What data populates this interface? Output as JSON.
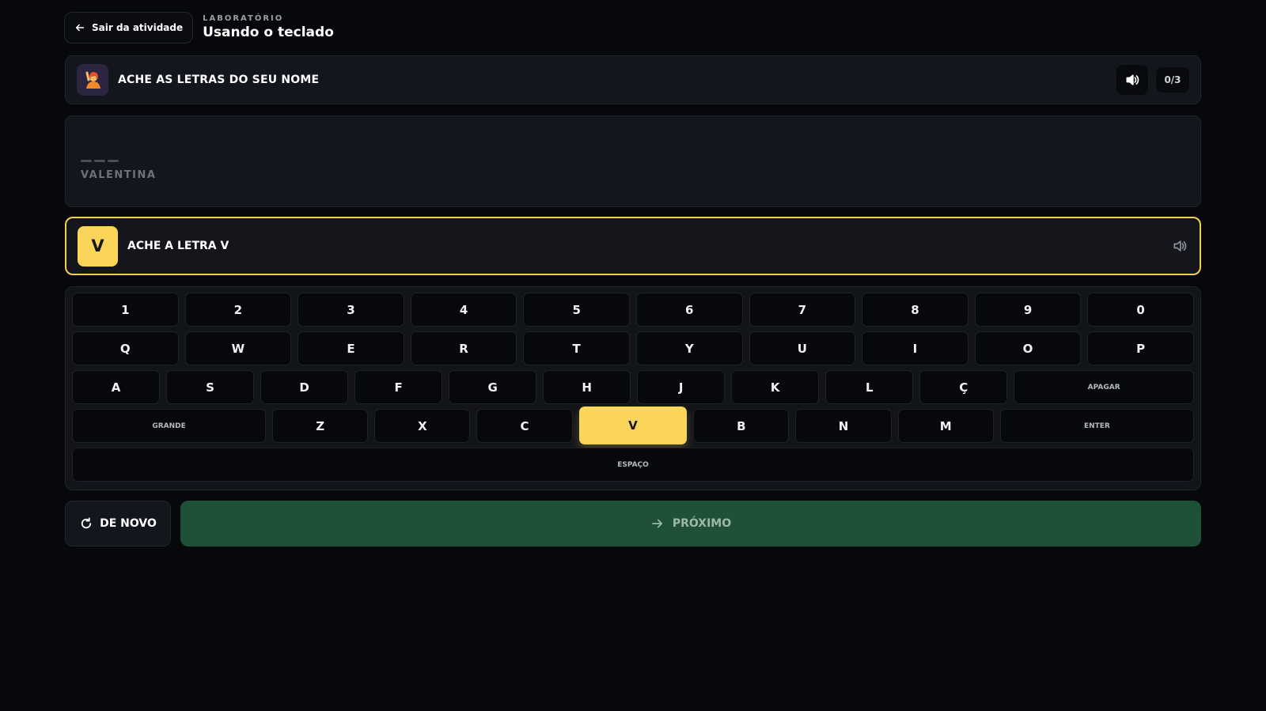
{
  "header": {
    "exit_label": "Sair da atividade",
    "section": "LABORATÓRIO",
    "title": "Usando o teclado"
  },
  "task": {
    "title": "ACHE AS LETRAS DO SEU NOME",
    "progress": "0/3",
    "icon": "person-raising-hand-icon"
  },
  "name_display": {
    "name": "VALENTINA"
  },
  "current_letter": {
    "letter": "V",
    "prompt": "ACHE A LETRA V"
  },
  "keyboard": {
    "row1": [
      "1",
      "2",
      "3",
      "4",
      "5",
      "6",
      "7",
      "8",
      "9",
      "0"
    ],
    "row2": [
      "Q",
      "W",
      "E",
      "R",
      "T",
      "Y",
      "U",
      "I",
      "O",
      "P"
    ],
    "row3": [
      "A",
      "S",
      "D",
      "F",
      "G",
      "H",
      "J",
      "K",
      "L",
      "Ç"
    ],
    "delete_label": "APAGAR",
    "shift_label": "GRANDE",
    "row4": [
      "Z",
      "X",
      "C",
      "V",
      "B",
      "N",
      "M"
    ],
    "enter_label": "ENTER",
    "space_label": "ESPAÇO",
    "highlighted": "V",
    "highlight_color": "#fbd55a"
  },
  "actions": {
    "again_label": "DE NOVO",
    "next_label": "PRÓXIMO",
    "next_color": "#1f5138"
  }
}
